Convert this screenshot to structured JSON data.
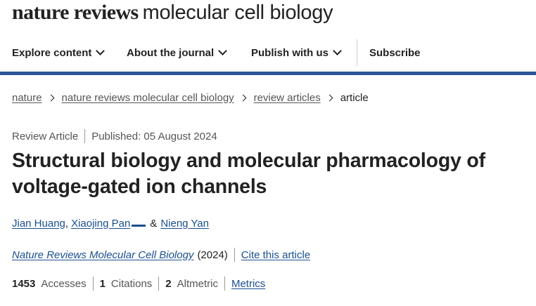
{
  "masthead": {
    "brand": "nature reviews",
    "journal": "molecular cell biology"
  },
  "nav": {
    "items": [
      {
        "label": "Explore content"
      },
      {
        "label": "About the journal"
      },
      {
        "label": "Publish with us"
      }
    ],
    "subscribe": "Subscribe"
  },
  "breadcrumb": [
    "nature",
    "nature reviews molecular cell biology",
    "review articles",
    "article"
  ],
  "article": {
    "type": "Review Article",
    "published": "Published: 05 August 2024",
    "title": "Structural biology and molecular pharmacology of voltage-gated ion channels",
    "authors": [
      "Jian Huang",
      "Xiaojing Pan",
      "Nieng Yan"
    ],
    "author_sep_comma": ",",
    "author_sep_amp": "&",
    "journal": "Nature Reviews Molecular Cell Biology",
    "year": "(2024)",
    "cite_label": "Cite this article"
  },
  "metrics": {
    "accesses_count": "1453",
    "accesses_label": "Accesses",
    "citations_count": "1",
    "citations_label": "Citations",
    "altmetric_count": "2",
    "altmetric_label": "Altmetric",
    "metrics_link": "Metrics"
  },
  "colors": {
    "accent_bar": "#2a5597",
    "link": "#1a4f8f",
    "text": "#222222",
    "muted": "#555555"
  }
}
